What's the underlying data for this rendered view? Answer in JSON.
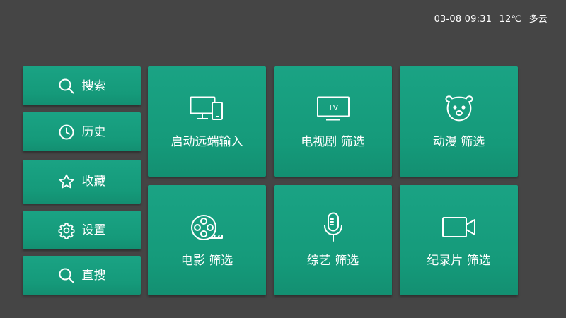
{
  "status": {
    "datetime": "03-08 09:31",
    "temperature": "12℃",
    "weather": "多云"
  },
  "sidebar": {
    "items": [
      {
        "label": "搜索",
        "icon": "search-icon"
      },
      {
        "label": "历史",
        "icon": "clock-icon"
      },
      {
        "label": "收藏",
        "icon": "star-icon"
      },
      {
        "label": "设置",
        "icon": "gear-icon"
      },
      {
        "label": "直搜",
        "icon": "search-icon"
      }
    ]
  },
  "tiles": [
    {
      "label": "启动远端输入",
      "icon": "monitor-phone-icon"
    },
    {
      "label": "电视剧 筛选",
      "icon": "tv-icon",
      "icon_text": "TV"
    },
    {
      "label": "动漫 筛选",
      "icon": "bear-face-icon"
    },
    {
      "label": "电影 筛选",
      "icon": "film-reel-icon"
    },
    {
      "label": "综艺 筛选",
      "icon": "microphone-icon"
    },
    {
      "label": "纪录片 筛选",
      "icon": "video-camera-icon"
    }
  ],
  "colors": {
    "background": "#454545",
    "tile": "#169d7d",
    "text": "#ffffff"
  }
}
